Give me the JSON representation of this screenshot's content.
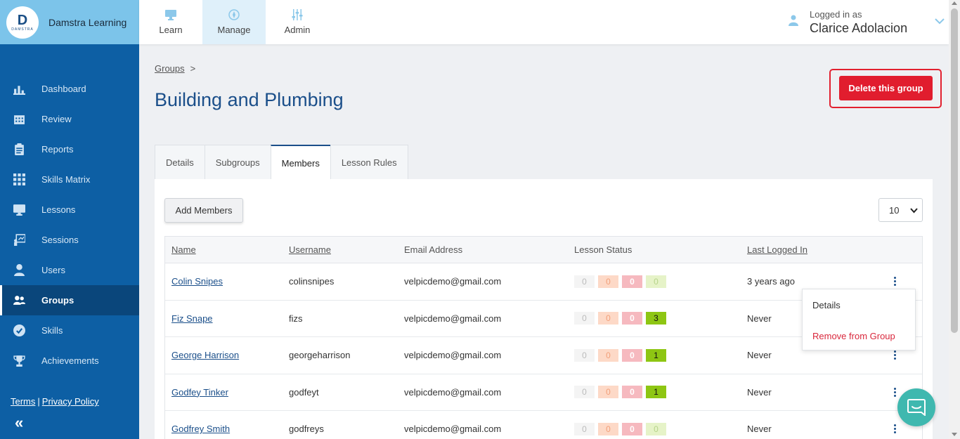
{
  "brand": {
    "name": "Damstra Learning",
    "logo_letter": "D",
    "logo_word": "DAMSTRA"
  },
  "sidebar": {
    "items": [
      {
        "label": "Dashboard",
        "icon": "bar-chart-icon"
      },
      {
        "label": "Review",
        "icon": "calendar-icon"
      },
      {
        "label": "Reports",
        "icon": "clipboard-icon"
      },
      {
        "label": "Skills Matrix",
        "icon": "grid-icon"
      },
      {
        "label": "Lessons",
        "icon": "monitor-icon"
      },
      {
        "label": "Sessions",
        "icon": "presentation-icon"
      },
      {
        "label": "Users",
        "icon": "user-icon"
      },
      {
        "label": "Groups",
        "icon": "users-icon",
        "active": true
      },
      {
        "label": "Skills",
        "icon": "check-circle-icon"
      },
      {
        "label": "Achievements",
        "icon": "trophy-icon"
      }
    ],
    "footer": {
      "terms": "Terms",
      "separator": "|",
      "privacy": "Privacy Policy"
    },
    "collapse_glyph": "«"
  },
  "topnav": {
    "items": [
      {
        "label": "Learn",
        "icon": "monitor-icon"
      },
      {
        "label": "Manage",
        "icon": "compass-icon",
        "active": true
      },
      {
        "label": "Admin",
        "icon": "sliders-icon"
      }
    ],
    "user": {
      "logged_in_label": "Logged in as",
      "name": "Clarice Adolacion"
    }
  },
  "breadcrumb": {
    "link": "Groups",
    "separator": ">"
  },
  "page": {
    "title": "Building and Plumbing",
    "delete_label": "Delete this group"
  },
  "tabs": [
    "Details",
    "Subgroups",
    "Members",
    "Lesson Rules"
  ],
  "members": {
    "add_label": "Add Members",
    "page_size": "10",
    "headers": {
      "name": "Name",
      "username": "Username",
      "email": "Email Address",
      "status": "Lesson Status",
      "last": "Last Logged In"
    },
    "rows": [
      {
        "name": "Colin Snipes",
        "username": "colinsnipes",
        "email": "velpicdemo@gmail.com",
        "status": [
          "0",
          "0",
          "0",
          "0"
        ],
        "last": "3 years ago"
      },
      {
        "name": "Fiz Snape",
        "username": "fizs",
        "email": "velpicdemo@gmail.com",
        "status": [
          "0",
          "0",
          "0",
          "3"
        ],
        "last": "Never"
      },
      {
        "name": "George Harrison",
        "username": "georgeharrison",
        "email": "velpicdemo@gmail.com",
        "status": [
          "0",
          "0",
          "0",
          "1"
        ],
        "last": "Never"
      },
      {
        "name": "Godfey Tinker",
        "username": "godfeyt",
        "email": "velpicdemo@gmail.com",
        "status": [
          "0",
          "0",
          "0",
          "1"
        ],
        "last": "Never"
      },
      {
        "name": "Godfrey Smith",
        "username": "godfreys",
        "email": "velpicdemo@gmail.com",
        "status": [
          "0",
          "0",
          "0",
          "0"
        ],
        "last": "Never"
      }
    ]
  },
  "row_menu": {
    "details": "Details",
    "remove": "Remove from Group"
  },
  "colors": {
    "sidebar": "#0d5fa4",
    "brand_bg": "#7cc4ea",
    "title": "#1b4f8a",
    "danger": "#e11d2e",
    "chat": "#3fb8af"
  }
}
